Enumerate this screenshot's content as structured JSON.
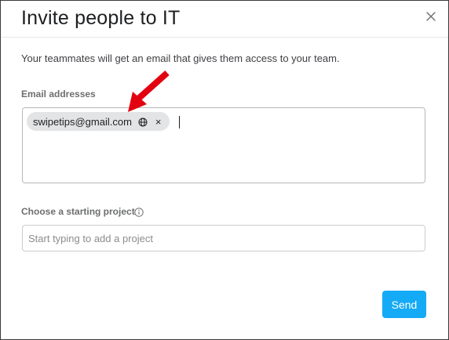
{
  "dialog": {
    "title": "Invite people to IT",
    "description": "Your teammates will get an email that gives them access to your team."
  },
  "email_field": {
    "label": "Email addresses",
    "chips": [
      {
        "text": "swipetips@gmail.com",
        "icon": "globe-icon",
        "remove_label": "×"
      }
    ]
  },
  "project_field": {
    "label": "Choose a starting project",
    "placeholder": "Start typing to add a project",
    "value": ""
  },
  "actions": {
    "send_label": "Send"
  },
  "colors": {
    "accent": "#14aaf5",
    "annotation_arrow": "#e3000f",
    "chip_bg": "#e3e4e6"
  }
}
